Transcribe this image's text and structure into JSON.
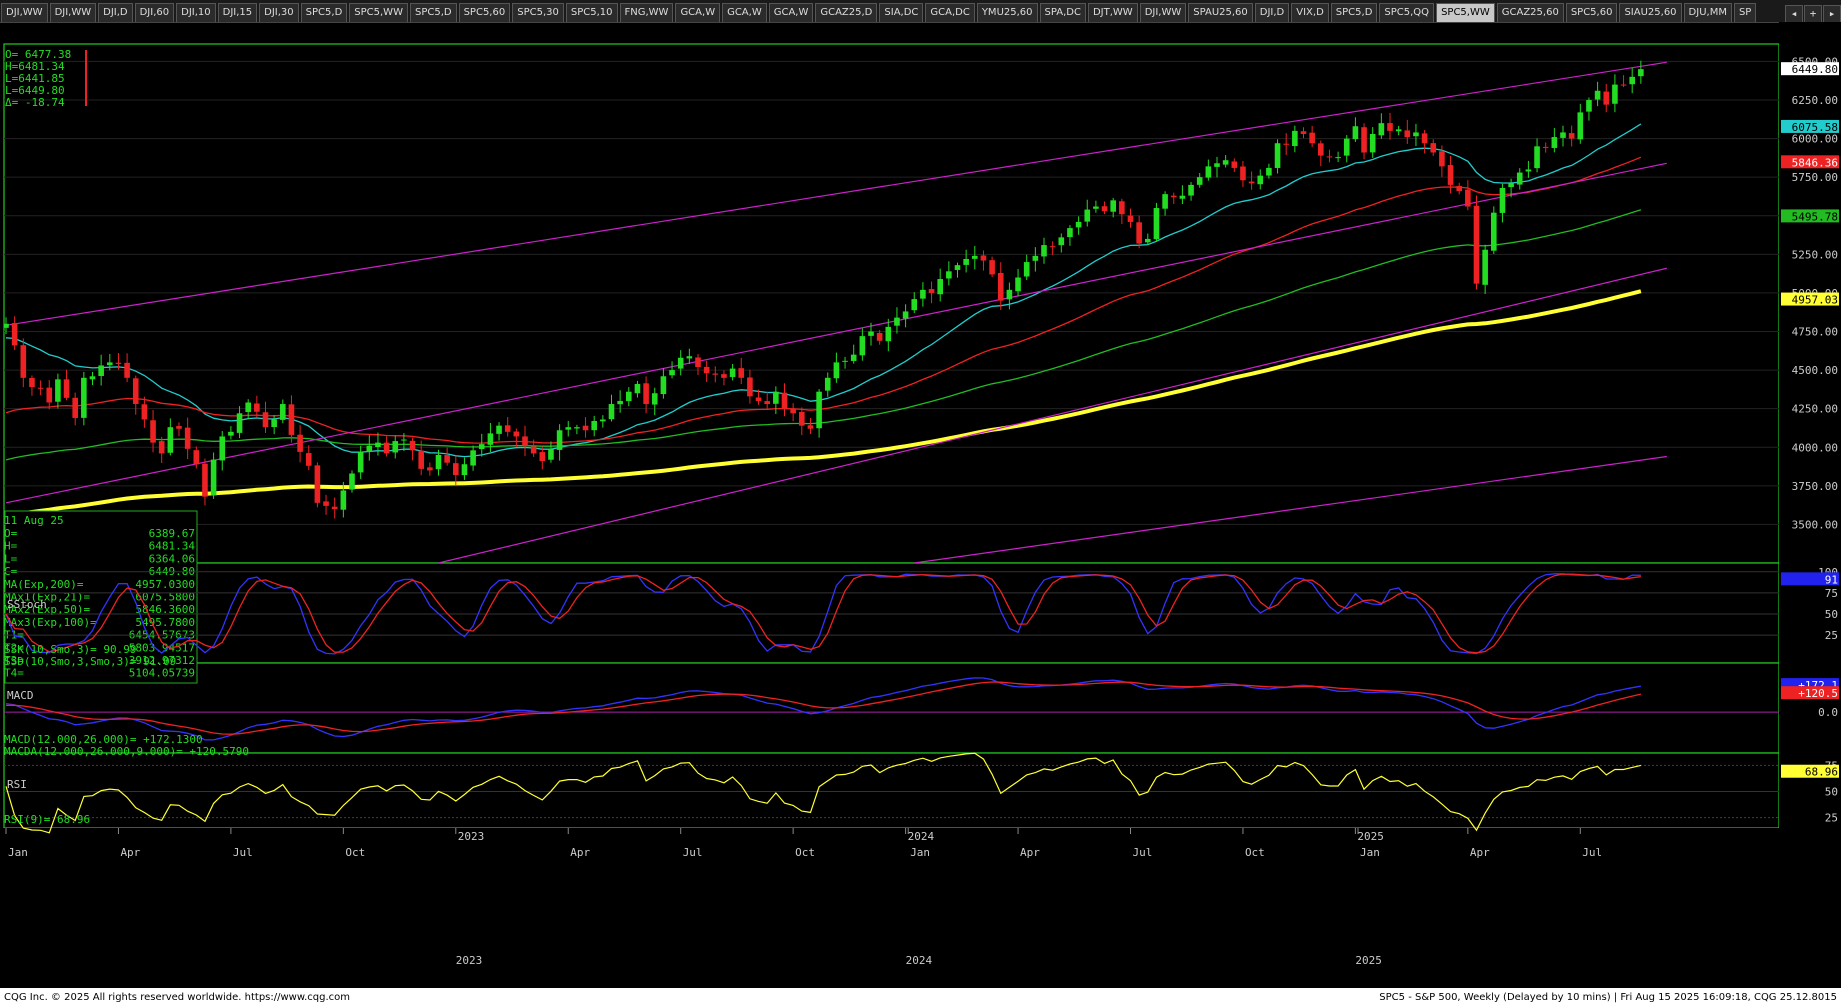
{
  "tabs": [
    "DJI,WW",
    "DJI,WW",
    "DJI,D",
    "DJI,60",
    "DJI,10",
    "DJI,15",
    "DJI,30",
    "SPC5,D",
    "SPC5,WW",
    "SPC5,D",
    "SPC5,60",
    "SPC5,30",
    "SPC5,10",
    "FNG,WW",
    "GCA,W",
    "GCA,W",
    "GCA,W",
    "GCAZ25,D",
    "SIA,DC",
    "GCA,DC",
    "YMU25,60",
    "SPA,DC",
    "DJT,WW",
    "DJI,WW",
    "SPAU25,60",
    "DJI,D",
    "VIX,D",
    "SPC5,D",
    "SPC5,QQ",
    "SPC5,WW",
    "GCAZ25,60",
    "SPC5,60",
    "SIAU25,60",
    "DJU,MM",
    "SP"
  ],
  "active_tab": 29,
  "footer": {
    "left": "CQG Inc. © 2025 All rights reserved worldwide. https://www.cqg.com",
    "right": "SPC5 - S&P 500, Weekly (Delayed by 10 mins) | Fri Aug 15 2025 16:09:18, CQG 25.12.8015"
  },
  "colors": {
    "up": "#22dd22",
    "down": "#ee2222",
    "ema21": "#22cccc",
    "ema50": "#ee2222",
    "ema100": "#22bb22",
    "ema200": "#ffff33",
    "trend": "#cc22cc",
    "panel_border": "#22cc22",
    "text": "#22dd22"
  },
  "chart_data": {
    "type": "candlestick",
    "symbol": "SPC5",
    "interval": "Weekly",
    "x_start_week_offset": -2.5,
    "x_labels": [
      {
        "week": 0,
        "text": "Jan"
      },
      {
        "week": 13,
        "text": "Apr"
      },
      {
        "week": 26,
        "text": "Jul"
      },
      {
        "week": 39,
        "text": "Oct"
      },
      {
        "week": 52,
        "text": "2023"
      },
      {
        "week": 65,
        "text": "Apr"
      },
      {
        "week": 78,
        "text": "Jul"
      },
      {
        "week": 91,
        "text": "Oct"
      },
      {
        "week": 104,
        "text": "2024"
      },
      {
        "week": 104.3,
        "text": "Jan"
      },
      {
        "week": 117,
        "text": "Apr"
      },
      {
        "week": 130,
        "text": "Jul"
      },
      {
        "week": 143,
        "text": "Oct"
      },
      {
        "week": 156,
        "text": "2025"
      },
      {
        "week": 156.3,
        "text": "Jan"
      },
      {
        "week": 169,
        "text": "Apr"
      },
      {
        "week": 182,
        "text": "Jul"
      }
    ],
    "price_axis": {
      "ylim": [
        3250,
        6600
      ],
      "ticks": [
        3500,
        3750,
        4000,
        4250,
        4500,
        4750,
        5000,
        5250,
        5500,
        5750,
        6000,
        6250,
        6500
      ]
    },
    "closes": [
      4800,
      4660,
      4450,
      4390,
      4380,
      4290,
      4440,
      4320,
      4190,
      4450,
      4460,
      4530,
      4550,
      4540,
      4450,
      4280,
      4180,
      4030,
      3960,
      4130,
      4120,
      3990,
      3890,
      3680,
      3920,
      4070,
      4100,
      4220,
      4290,
      4230,
      4130,
      4180,
      4280,
      4080,
      3970,
      3880,
      3640,
      3620,
      3600,
      3720,
      3830,
      3970,
      4010,
      4030,
      3960,
      4040,
      4050,
      3980,
      3860,
      3850,
      3950,
      3900,
      3820,
      3890,
      3980,
      4020,
      4090,
      4140,
      4100,
      4070,
      4010,
      3960,
      3910,
      3990,
      4110,
      4130,
      4130,
      4110,
      4170,
      4180,
      4280,
      4300,
      4360,
      4410,
      4280,
      4350,
      4460,
      4500,
      4580,
      4590,
      4520,
      4480,
      4470,
      4450,
      4510,
      4450,
      4330,
      4300,
      4280,
      4360,
      4250,
      4220,
      4140,
      4120,
      4360,
      4450,
      4550,
      4560,
      4600,
      4720,
      4750,
      4690,
      4780,
      4840,
      4880,
      4960,
      5020,
      5000,
      5090,
      5140,
      5180,
      5220,
      5240,
      5210,
      5120,
      4950,
      5020,
      5100,
      5200,
      5240,
      5310,
      5300,
      5360,
      5420,
      5460,
      5540,
      5560,
      5530,
      5600,
      5510,
      5460,
      5320,
      5350,
      5550,
      5640,
      5620,
      5630,
      5700,
      5750,
      5820,
      5840,
      5860,
      5810,
      5730,
      5710,
      5760,
      5810,
      5970,
      5960,
      6050,
      6030,
      5970,
      5890,
      5880,
      5880,
      6000,
      6080,
      5910,
      6030,
      6100,
      6050,
      6060,
      6010,
      6040,
      5970,
      5910,
      5820,
      5700,
      5660,
      5560,
      5060,
      5280,
      5520,
      5680,
      5710,
      5780,
      5800,
      5950,
      5940,
      6010,
      6040,
      6000,
      6170,
      6250,
      6310,
      6220,
      6350,
      6350,
      6400,
      6450
    ],
    "emas": [
      {
        "name": "MA(Exp,200)",
        "value": "4957.0300",
        "color": "#ffff33",
        "length": 200,
        "width": 4
      },
      {
        "name": "MAx1(Exp,21)",
        "value": "6075.5800",
        "color": "#22cccc",
        "length": 21,
        "width": 1.3
      },
      {
        "name": "MAx2(Exp,50)",
        "value": "5846.3600",
        "color": "#ee2222",
        "length": 50,
        "width": 1.3
      },
      {
        "name": "MAx3(Exp,100)",
        "value": "5495.7800",
        "color": "#22bb22",
        "length": 100,
        "width": 1.3
      }
    ],
    "trendlines": [
      {
        "name": "T1",
        "value": "6454.57673"
      },
      {
        "name": "T2",
        "value": "5803.94517"
      },
      {
        "name": "T3",
        "value": "3912.97312"
      },
      {
        "name": "T4",
        "value": "5104.05739"
      }
    ],
    "ohlc_box": {
      "lines": [
        "O=  6477.38",
        "H=6481.34",
        "L=6441.85",
        "L=6449.80",
        "Δ=  -18.74"
      ]
    },
    "info_box": {
      "date": "11 Aug 25",
      "rows": [
        [
          "O=",
          "6389.67"
        ],
        [
          "H=",
          "6481.34"
        ],
        [
          "L=",
          "6364.06"
        ],
        [
          "C=",
          "6449.80"
        ],
        [
          "MA(Exp,200)=",
          "4957.0300"
        ],
        [
          "MAx1(Exp,21)=",
          "6075.5800"
        ],
        [
          "MAx2(Exp,50)=",
          "5846.3600"
        ],
        [
          "MAx3(Exp,100)=",
          "5495.7800"
        ],
        [
          "T1=",
          "6454.57673"
        ],
        [
          "T2=",
          "5803.94517"
        ],
        [
          "T3=",
          "3912.97312"
        ],
        [
          "T4=",
          "5104.05739"
        ]
      ]
    },
    "price_tags": [
      {
        "text": "6449.80",
        "value": 6449.8,
        "bg": "#ffffff",
        "fg": "#000000"
      },
      {
        "text": "6075.58",
        "value": 6075.58,
        "bg": "#22cccc",
        "fg": "#000000"
      },
      {
        "text": "5846.36",
        "value": 5846.36,
        "bg": "#ee2222",
        "fg": "#ffffff"
      },
      {
        "text": "5495.78",
        "value": 5495.78,
        "bg": "#22bb22",
        "fg": "#000000"
      },
      {
        "text": "4957.03",
        "value": 4957.03,
        "bg": "#ffff33",
        "fg": "#000000"
      }
    ],
    "stoch": {
      "title": "SStoch",
      "ylim": [
        0,
        100
      ],
      "ticks": [
        25,
        50,
        75,
        100
      ],
      "labels": [
        "SSK(10,Smo,3)=        90.99",
        "SSD(10,Smo,3,Smo,3)=   91.09"
      ],
      "tag": {
        "text": "91",
        "value": 91,
        "bg": "#2222ee",
        "fg": "#ffffff"
      }
    },
    "macd": {
      "title": "MACD",
      "ticks": [
        {
          "value": 0,
          "text": "0.0"
        }
      ],
      "labels": [
        "MACD(12.000,26.000)=          +172.1300",
        "MACDA(12.000,26.000,9.000)= +120.5790"
      ],
      "tags": [
        {
          "text": "+172.1",
          "value": 172.13,
          "bg": "#2222ee",
          "fg": "#ffffff"
        },
        {
          "text": "+120.5",
          "value": 120.58,
          "bg": "#ee2222",
          "fg": "#ffffff"
        }
      ]
    },
    "rsi": {
      "title": "RSI",
      "ylim": [
        15,
        85
      ],
      "ticks": [
        25,
        50,
        75
      ],
      "labels": [
        "RSI(9)=  68.96"
      ],
      "tag": {
        "text": "68.96",
        "value": 68.96,
        "bg": "#ffff33",
        "fg": "#000000"
      }
    }
  }
}
